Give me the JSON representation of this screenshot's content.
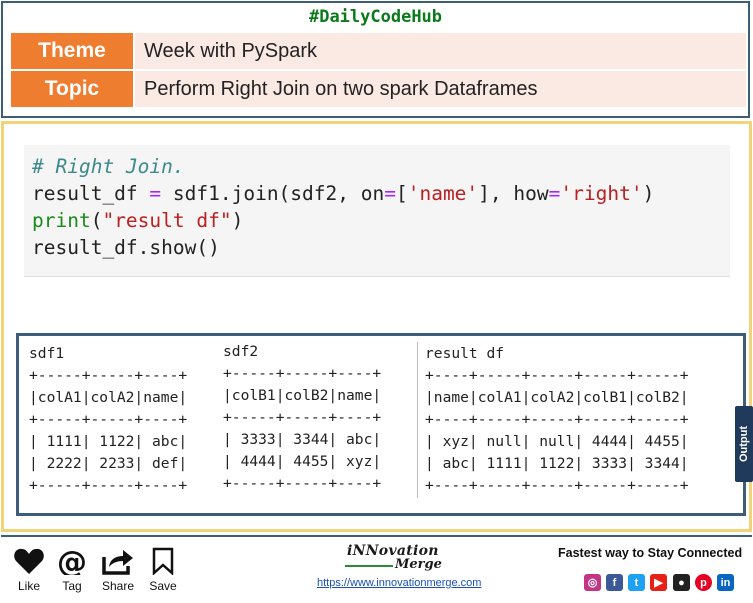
{
  "header": {
    "hashtag": "#DailyCodeHub",
    "rows": [
      {
        "label": "Theme",
        "value": "Week with PySpark"
      },
      {
        "label": "Topic",
        "value": "Perform Right Join on two spark Dataframes"
      }
    ]
  },
  "code": {
    "comment": "# Right Join.",
    "line2": {
      "a": "result_df ",
      "eq": "=",
      "b": " sdf1.join(sdf2, on",
      "eq2": "=",
      "c": "[",
      "s1": "'name'",
      "d": "], how",
      "eq3": "=",
      "s2": "'right'",
      "e": ")"
    },
    "line3": {
      "fn": "print",
      "a": "(",
      "s": "\"result df\"",
      "b": ")"
    },
    "line4": "result_df.show()"
  },
  "output": {
    "sdf1": "sdf1\n+-----+-----+----+\n|colA1|colA2|name|\n+-----+-----+----+\n| 1111| 1122| abc|\n| 2222| 2233| def|\n+-----+-----+----+",
    "sdf2": "sdf2\n+-----+-----+----+\n|colB1|colB2|name|\n+-----+-----+----+\n| 3333| 3344| abc|\n| 4444| 4455| xyz|\n+-----+-----+----+",
    "result": "result df\n+----+-----+-----+-----+-----+\n|name|colA1|colA2|colB1|colB2|\n+----+-----+-----+-----+-----+\n| xyz| null| null| 4444| 4455|\n| abc| 1111| 1122| 3333| 3344|\n+----+-----+-----+-----+-----+",
    "tab_label": "Output"
  },
  "footer": {
    "actions": [
      {
        "label": "Like",
        "icon": "heart-icon"
      },
      {
        "label": "Tag",
        "icon": "at-icon"
      },
      {
        "label": "Share",
        "icon": "share-icon"
      },
      {
        "label": "Save",
        "icon": "bookmark-icon"
      }
    ],
    "logo_line1": "iNNovation",
    "logo_line2": "Merge",
    "website": "https://www.innovationmerge.com",
    "tagline": "Fastest way to Stay Connected",
    "socials": [
      {
        "icon": "instagram-icon",
        "color": "#c13584"
      },
      {
        "icon": "facebook-icon",
        "color": "#3b5998"
      },
      {
        "icon": "twitter-icon",
        "color": "#1da1f2"
      },
      {
        "icon": "youtube-icon",
        "color": "#e62117"
      },
      {
        "icon": "github-icon",
        "color": "#222222"
      },
      {
        "icon": "pinterest-icon",
        "color": "#e60023"
      },
      {
        "icon": "linkedin-icon",
        "color": "#0a66c2"
      }
    ]
  }
}
